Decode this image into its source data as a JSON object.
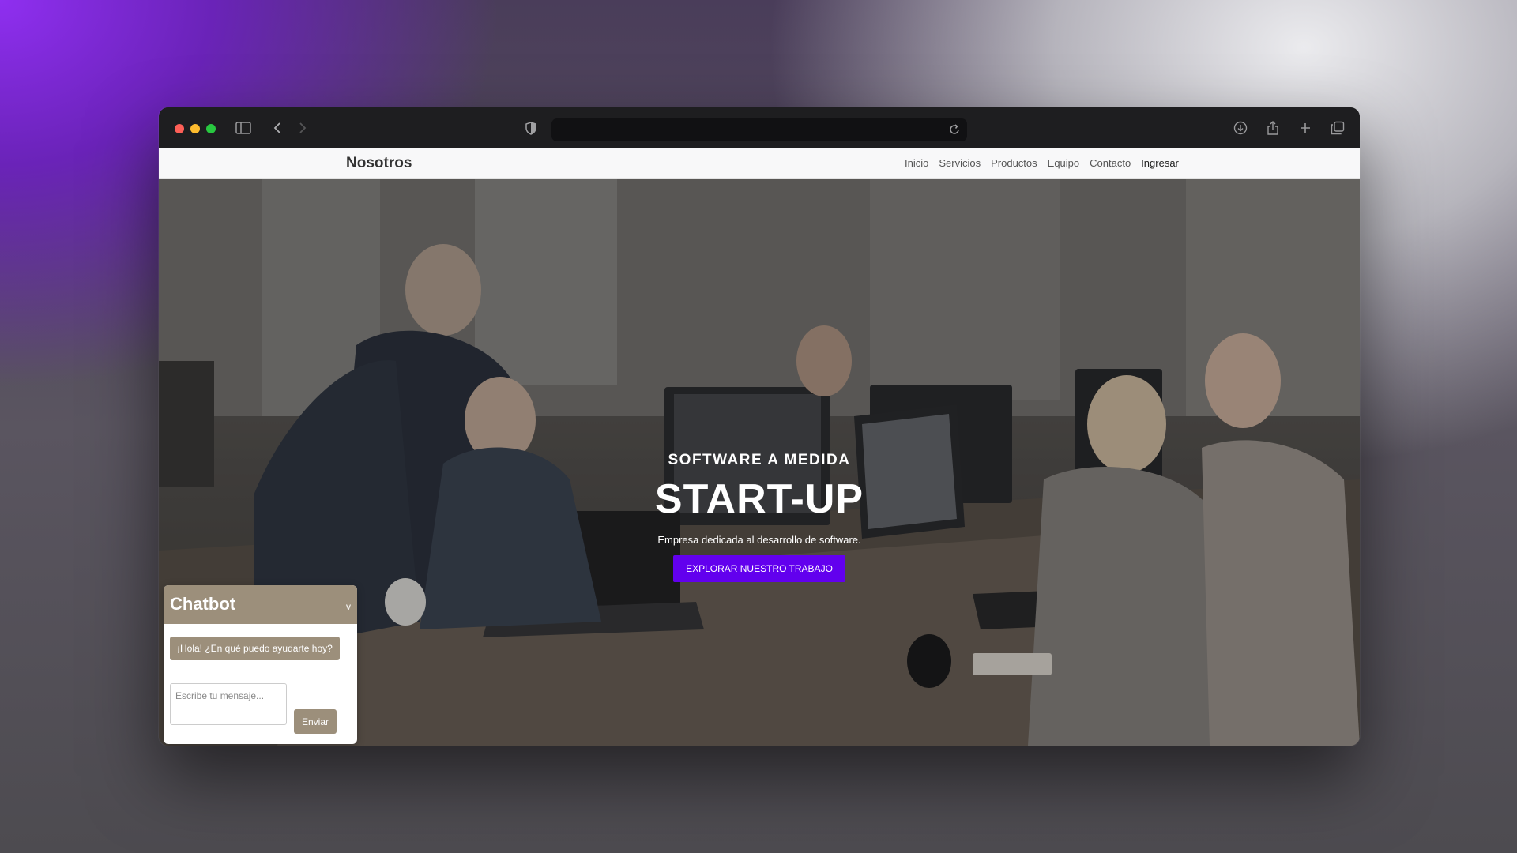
{
  "browser": {
    "url": "",
    "icons": [
      "sidebar-icon",
      "back-icon",
      "forward-icon",
      "shield-icon",
      "reload-icon",
      "download-icon",
      "share-icon",
      "new-tab-icon",
      "tabs-overview-icon"
    ]
  },
  "navbar": {
    "brand": "Nosotros",
    "links": [
      "Inicio",
      "Servicios",
      "Productos",
      "Equipo",
      "Contacto",
      "Ingresar"
    ]
  },
  "hero": {
    "eyebrow": "SOFTWARE A MEDIDA",
    "title": "START-UP",
    "subtitle": "Empresa dedicada al desarrollo de software.",
    "button_label": "EXPLORAR NUESTRO TRABAJO",
    "button_color": "#6200ee"
  },
  "chatbot": {
    "title": "Chatbot",
    "toggle": "v",
    "greeting": "¡Hola! ¿En qué puedo ayudarte hoy?",
    "input_placeholder": "Escribe tu mensaje...",
    "send_label": "Enviar",
    "accent_color": "#9c8f7b"
  }
}
